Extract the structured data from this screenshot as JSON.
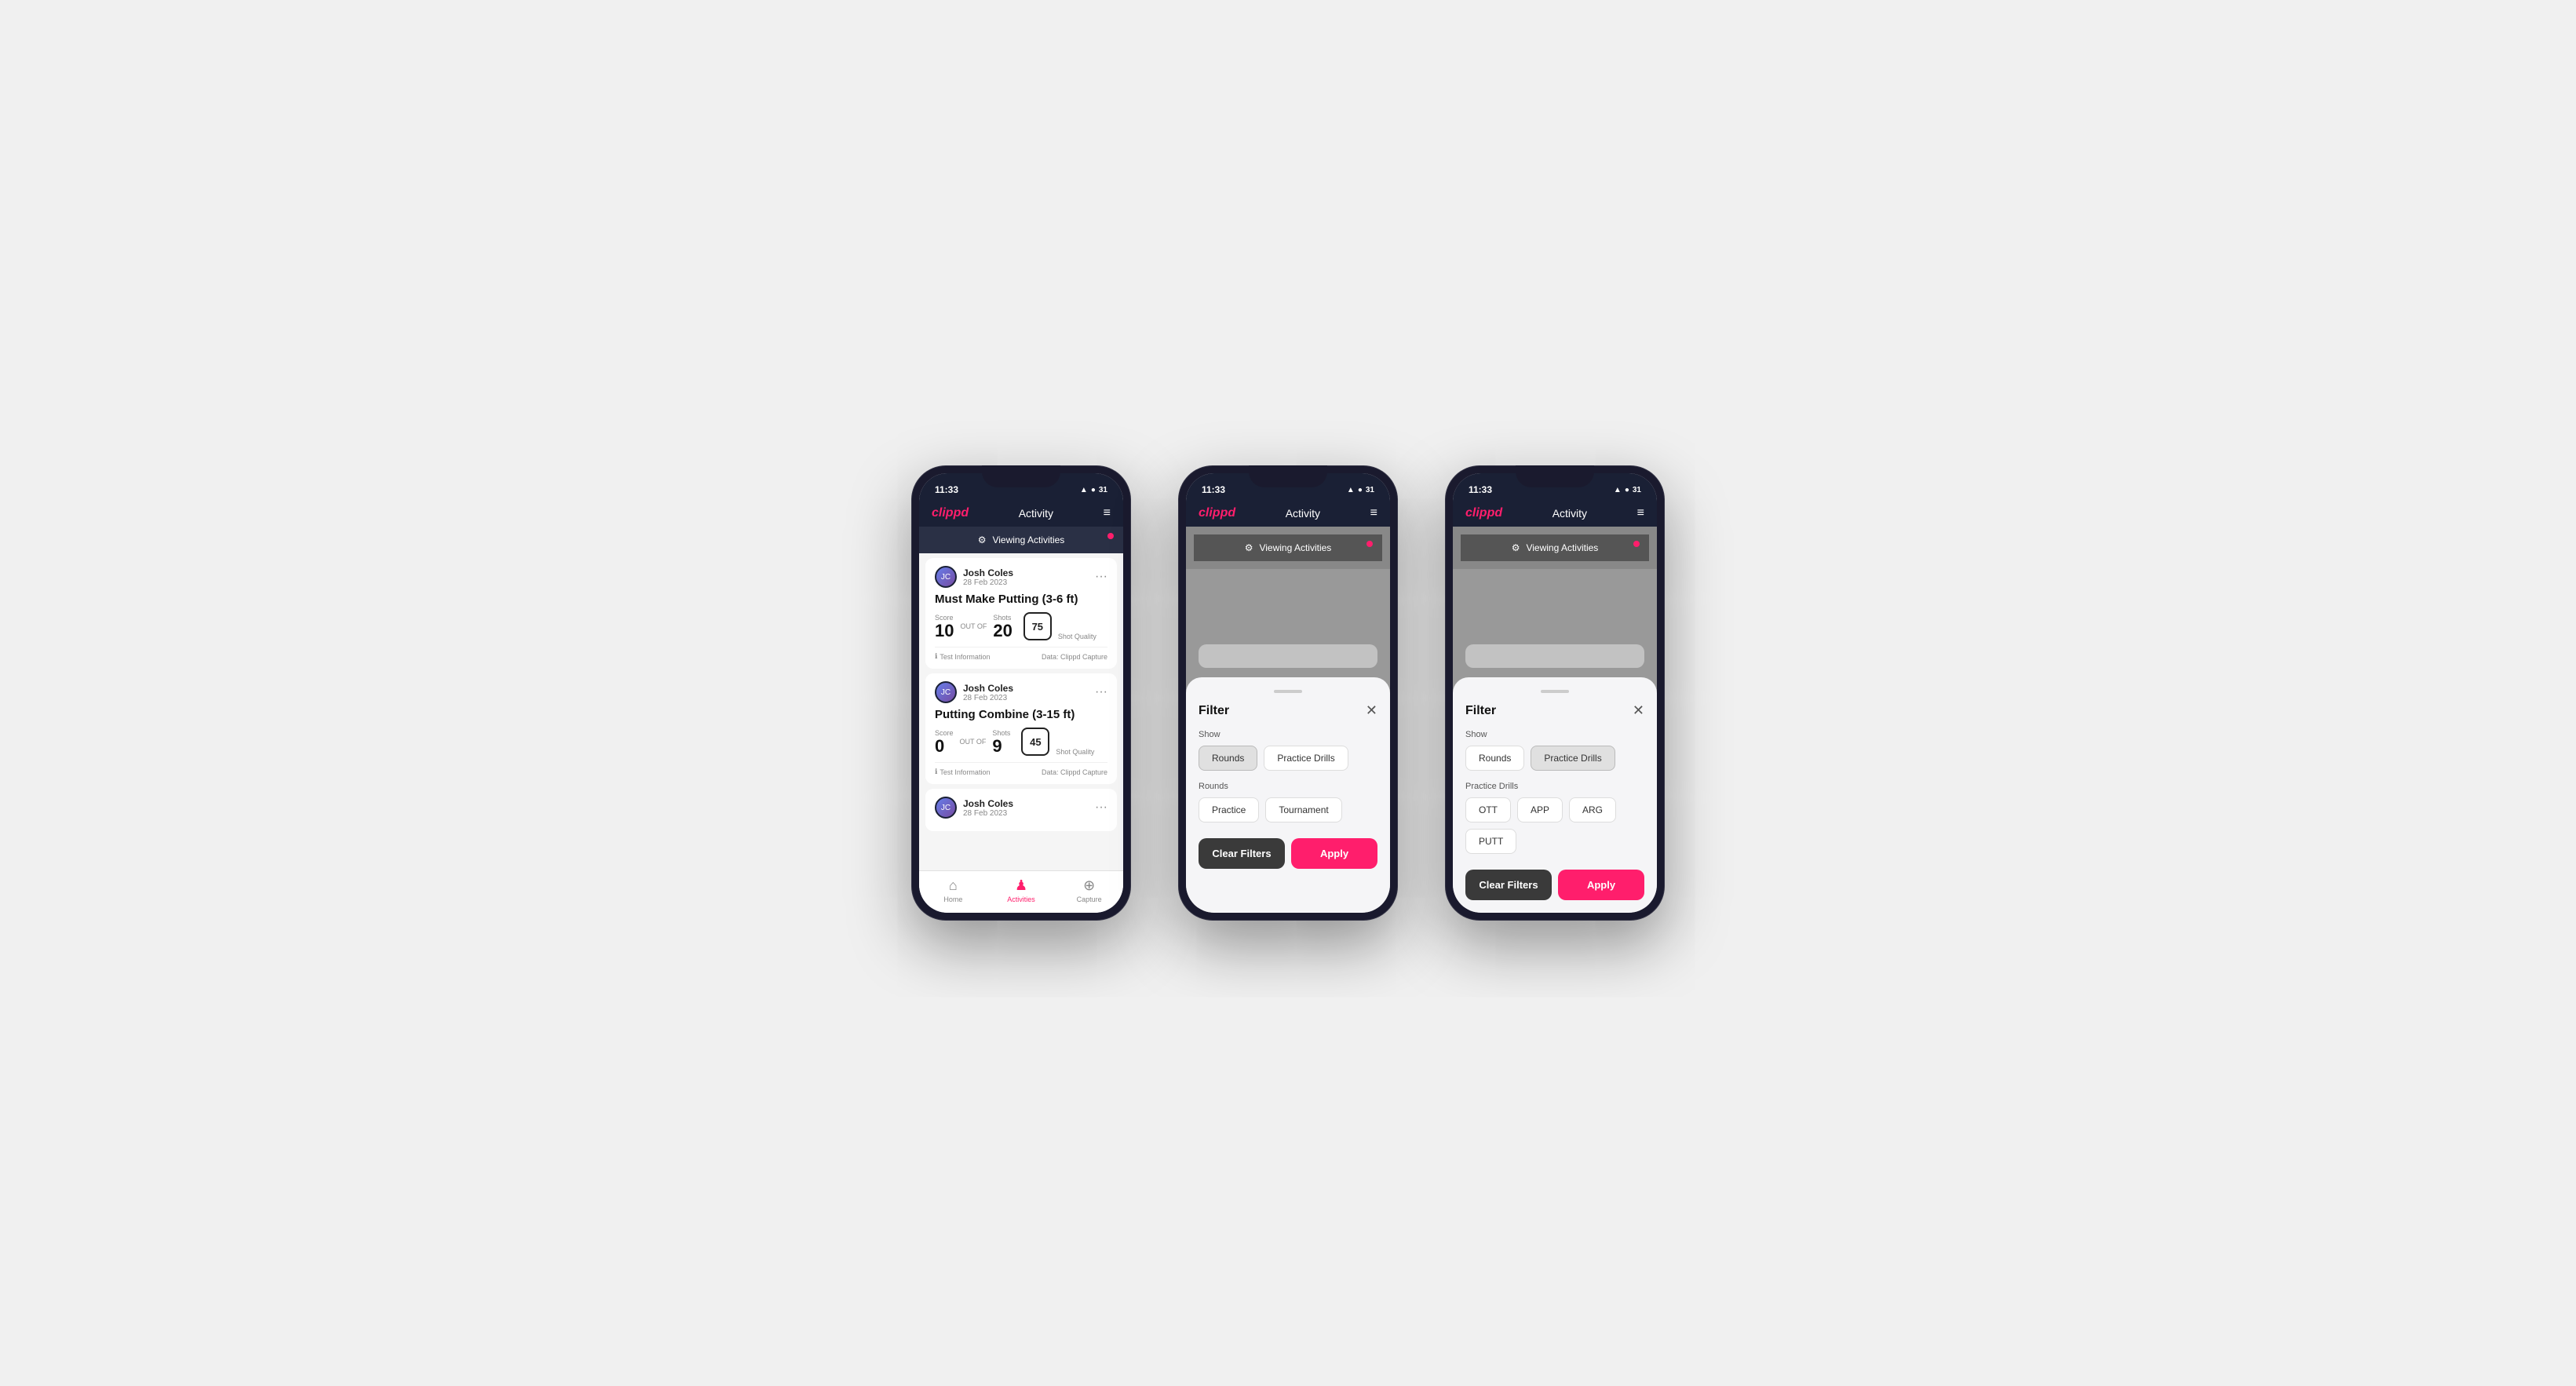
{
  "app": {
    "logo": "clippd",
    "header_title": "Activity",
    "menu_icon": "≡",
    "status_time": "11:33",
    "status_icons": "▲ ● 31"
  },
  "viewing_bar": {
    "label": "Viewing Activities",
    "icon": "⚙"
  },
  "activities": [
    {
      "user_name": "Josh Coles",
      "user_date": "28 Feb 2023",
      "title": "Must Make Putting (3-6 ft)",
      "score_label": "Score",
      "score_value": "10",
      "shots_label": "Shots",
      "shots_value": "20",
      "shot_quality_label": "Shot Quality",
      "shot_quality_value": "75",
      "out_of": "OUT OF",
      "test_info": "Test Information",
      "data_source": "Data: Clippd Capture"
    },
    {
      "user_name": "Josh Coles",
      "user_date": "28 Feb 2023",
      "title": "Putting Combine (3-15 ft)",
      "score_label": "Score",
      "score_value": "0",
      "shots_label": "Shots",
      "shots_value": "9",
      "shot_quality_label": "Shot Quality",
      "shot_quality_value": "45",
      "out_of": "OUT OF",
      "test_info": "Test Information",
      "data_source": "Data: Clippd Capture"
    },
    {
      "user_name": "Josh Coles",
      "user_date": "28 Feb 2023",
      "title": "",
      "score_label": "",
      "score_value": "",
      "shots_label": "",
      "shots_value": "",
      "shot_quality_label": "",
      "shot_quality_value": "",
      "out_of": "",
      "test_info": "",
      "data_source": ""
    }
  ],
  "bottom_nav": [
    {
      "label": "Home",
      "icon": "⌂",
      "active": false
    },
    {
      "label": "Activities",
      "icon": "♟",
      "active": true
    },
    {
      "label": "Capture",
      "icon": "⊕",
      "active": false
    }
  ],
  "filter_phone2": {
    "title": "Filter",
    "show_label": "Show",
    "show_buttons": [
      {
        "label": "Rounds",
        "active": true
      },
      {
        "label": "Practice Drills",
        "active": false
      }
    ],
    "rounds_label": "Rounds",
    "rounds_buttons": [
      {
        "label": "Practice",
        "active": false
      },
      {
        "label": "Tournament",
        "active": false
      }
    ],
    "clear_label": "Clear Filters",
    "apply_label": "Apply"
  },
  "filter_phone3": {
    "title": "Filter",
    "show_label": "Show",
    "show_buttons": [
      {
        "label": "Rounds",
        "active": false
      },
      {
        "label": "Practice Drills",
        "active": true
      }
    ],
    "drills_label": "Practice Drills",
    "drills_buttons": [
      {
        "label": "OTT",
        "active": false
      },
      {
        "label": "APP",
        "active": false
      },
      {
        "label": "ARG",
        "active": false
      },
      {
        "label": "PUTT",
        "active": false
      }
    ],
    "clear_label": "Clear Filters",
    "apply_label": "Apply"
  }
}
